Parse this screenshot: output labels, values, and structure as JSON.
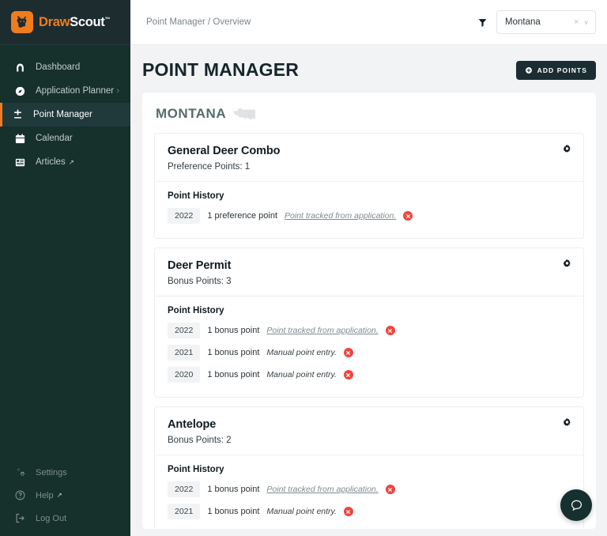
{
  "brand": {
    "name_part1": "Draw",
    "name_part2": "Scout",
    "trademark": "™",
    "logo_icon": "elk-head-icon",
    "accent_color": "#f07c1e"
  },
  "sidebar": {
    "items": [
      {
        "label": "Dashboard",
        "icon": "home-icon",
        "active": false,
        "external": false,
        "chevron": false
      },
      {
        "label": "Application Planner",
        "icon": "compass-icon",
        "active": false,
        "external": false,
        "chevron": true
      },
      {
        "label": "Point Manager",
        "icon": "plus-minus-icon",
        "active": true,
        "external": false,
        "chevron": false
      },
      {
        "label": "Calendar",
        "icon": "calendar-icon",
        "active": false,
        "external": false,
        "chevron": false
      },
      {
        "label": "Articles",
        "icon": "book-icon",
        "active": false,
        "external": true,
        "chevron": false
      }
    ],
    "bottom_items": [
      {
        "label": "Settings",
        "icon": "gears-icon",
        "external": false
      },
      {
        "label": "Help",
        "icon": "question-circle-icon",
        "external": true
      },
      {
        "label": "Log Out",
        "icon": "logout-icon",
        "external": false
      }
    ],
    "external_marker": "↗",
    "chevron_glyph": "›",
    "background_color": "#16302c",
    "active_accent": "#f07c1e"
  },
  "topbar": {
    "breadcrumb": "Point Manager / Overview",
    "filter_icon": "filter-funnel-icon",
    "state_select": {
      "value": "Montana",
      "clear_glyph": "×",
      "chevron_glyph": "∨"
    }
  },
  "page": {
    "title": "POINT MANAGER",
    "add_button": {
      "label": "ADD POINTS",
      "icon": "circle-plus-icon"
    },
    "state_heading": "MONTANA",
    "state_flag_icon": "montana-state-shape-icon"
  },
  "cards": [
    {
      "title": "General Deer Combo",
      "points_label": "Preference Points: 1",
      "settings_icon": "gear-icon",
      "history_title": "Point History",
      "history": [
        {
          "year": "2022",
          "amount": "1 preference point",
          "note": "Point tracked from application.",
          "note_linked": true,
          "delete_icon": "delete-circle-icon"
        }
      ]
    },
    {
      "title": "Deer Permit",
      "points_label": "Bonus Points: 3",
      "settings_icon": "gear-icon",
      "history_title": "Point History",
      "history": [
        {
          "year": "2022",
          "amount": "1 bonus point",
          "note": "Point tracked from application.",
          "note_linked": true,
          "delete_icon": "delete-circle-icon"
        },
        {
          "year": "2021",
          "amount": "1 bonus point",
          "note": "Manual point entry.",
          "note_linked": false,
          "delete_icon": "delete-circle-icon"
        },
        {
          "year": "2020",
          "amount": "1 bonus point",
          "note": "Manual point entry.",
          "note_linked": false,
          "delete_icon": "delete-circle-icon"
        }
      ]
    },
    {
      "title": "Antelope",
      "points_label": "Bonus Points: 2",
      "settings_icon": "gear-icon",
      "history_title": "Point History",
      "history": [
        {
          "year": "2022",
          "amount": "1 bonus point",
          "note": "Point tracked from application.",
          "note_linked": true,
          "delete_icon": "delete-circle-icon"
        },
        {
          "year": "2021",
          "amount": "1 bonus point",
          "note": "Manual point entry.",
          "note_linked": false,
          "delete_icon": "delete-circle-icon"
        }
      ]
    }
  ],
  "chat_widget": {
    "icon": "chat-bubble-icon"
  }
}
